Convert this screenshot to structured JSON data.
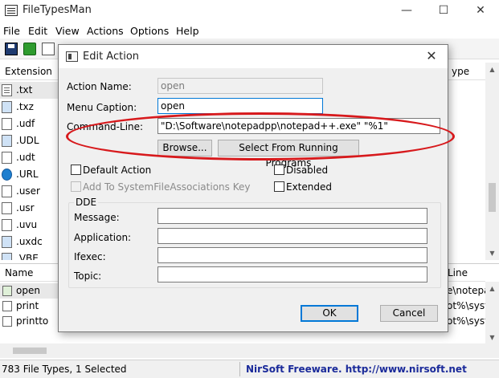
{
  "app": {
    "title": "FileTypesMan",
    "minimize": "—",
    "maximize": "☐",
    "close": "✕"
  },
  "menu": [
    "File",
    "Edit",
    "View",
    "Actions",
    "Options",
    "Help"
  ],
  "upper_list": {
    "col_extension": "Extension",
    "col_right": "ype",
    "rows": [
      ".txt",
      ".txz",
      ".udf",
      ".UDL",
      ".udt",
      ".URL",
      ".user",
      ".usr",
      ".uvu",
      ".uxdc",
      ".VBE"
    ]
  },
  "lower_list": {
    "col_name": "Name",
    "col_line": "Line",
    "rows": [
      {
        "name": "open",
        "line": "e\\notepadpp"
      },
      {
        "name": "print",
        "line": "ot%\\system"
      },
      {
        "name": "printto",
        "line": "ot%\\system"
      }
    ]
  },
  "status": {
    "left": "783 File Types, 1 Selected",
    "right": "NirSoft Freeware.  http://www.nirsoft.net"
  },
  "dialog": {
    "title": "Edit Action",
    "close": "✕",
    "action_name_label": "Action Name:",
    "action_name_value": "open",
    "menu_caption_label": "Menu Caption:",
    "menu_caption_value": "open",
    "command_line_label": "Command-Line:",
    "command_line_value": "\"D:\\Software\\notepadpp\\notepad++.exe\" \"%1\"",
    "browse_button": "Browse...",
    "select_running_button": "Select From Running Programs",
    "default_action": "Default Action",
    "disabled": "Disabled",
    "add_sfa": "Add To SystemFileAssociations Key",
    "extended": "Extended",
    "dde_title": "DDE",
    "message_label": "Message:",
    "application_label": "Application:",
    "ifexec_label": "Ifexec:",
    "topic_label": "Topic:",
    "ok_button": "OK",
    "cancel_button": "Cancel"
  },
  "colors": {
    "highlight_ring": "#d7191c",
    "status_link": "#1a2a9a",
    "focus_border": "#0078d7"
  }
}
